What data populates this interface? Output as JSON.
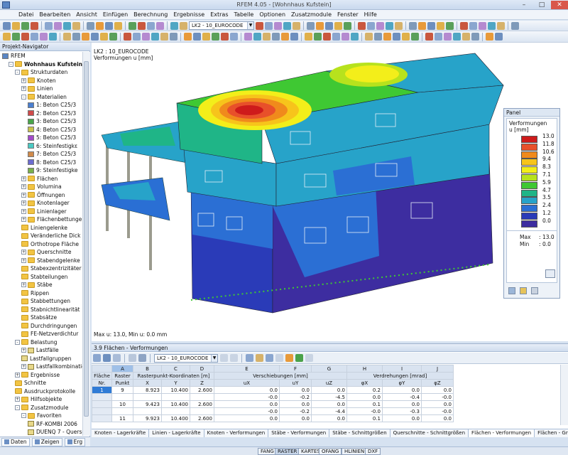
{
  "window": {
    "title": "RFEM 4.05 - [Wohnhaus Kufstein]",
    "controls": [
      "–",
      "□",
      "✕"
    ]
  },
  "menu": [
    "Datei",
    "Bearbeiten",
    "Ansicht",
    "Einfügen",
    "Berechnung",
    "Ergebnisse",
    "Extras",
    "Tabelle",
    "Optionen",
    "Zusatzmodule",
    "Fenster",
    "Hilfe"
  ],
  "toolbar": {
    "loadcase_combo": "LK2 - 10_EUROCODE"
  },
  "navigator": {
    "header": "Projekt-Navigator",
    "tree": [
      {
        "label": "RFEM",
        "level": 0,
        "icon": "rfem"
      },
      {
        "label": "Wohnhaus Kufstein [Eige",
        "level": 1,
        "icon": "folder",
        "bold": true,
        "exp": "-"
      },
      {
        "label": "Strukturdaten",
        "level": 2,
        "icon": "folder",
        "exp": "-"
      },
      {
        "label": "Knoten",
        "level": 3,
        "icon": "folder",
        "exp": "+"
      },
      {
        "label": "Linien",
        "level": 3,
        "icon": "folder",
        "exp": "+"
      },
      {
        "label": "Materialien",
        "level": 3,
        "icon": "folder",
        "exp": "-"
      },
      {
        "label": "1: Beton C25/3",
        "level": 4,
        "icon": "mat",
        "color": "#4a7fd0"
      },
      {
        "label": "2: Beton C25/3",
        "level": 4,
        "icon": "mat",
        "color": "#d04a4a"
      },
      {
        "label": "3: Beton C25/3",
        "level": 4,
        "icon": "mat",
        "color": "#49a54a"
      },
      {
        "label": "4: Beton C25/3",
        "level": 4,
        "icon": "mat",
        "color": "#c9c24a"
      },
      {
        "label": "5: Beton C25/3",
        "level": 4,
        "icon": "mat",
        "color": "#a24ac9"
      },
      {
        "label": "6: Steinfestigkε",
        "level": 4,
        "icon": "mat",
        "color": "#4ac9c2"
      },
      {
        "label": "7: Beton C25/3",
        "level": 4,
        "icon": "mat",
        "color": "#d08a4a"
      },
      {
        "label": "8: Beton C25/3",
        "level": 4,
        "icon": "mat",
        "color": "#6b6bd0"
      },
      {
        "label": "9: Steinfestigke",
        "level": 4,
        "icon": "mat",
        "color": "#7ab04a"
      },
      {
        "label": "Flächen",
        "level": 3,
        "icon": "folder",
        "exp": "+"
      },
      {
        "label": "Volumina",
        "level": 3,
        "icon": "folder",
        "exp": "+"
      },
      {
        "label": "Öffnungen",
        "level": 3,
        "icon": "folder",
        "exp": "+"
      },
      {
        "label": "Knotenlager",
        "level": 3,
        "icon": "folder",
        "exp": "+"
      },
      {
        "label": "Linienlager",
        "level": 3,
        "icon": "folder",
        "exp": "+"
      },
      {
        "label": "Flächenbettungen",
        "level": 3,
        "icon": "folder",
        "exp": "+"
      },
      {
        "label": "Liniengelenke",
        "level": 3,
        "icon": "folder"
      },
      {
        "label": "Veränderliche Dick",
        "level": 3,
        "icon": "folder"
      },
      {
        "label": "Orthotrope Fläche",
        "level": 3,
        "icon": "folder"
      },
      {
        "label": "Querschnitte",
        "level": 3,
        "icon": "folder",
        "exp": "+"
      },
      {
        "label": "Stabendgelenke",
        "level": 3,
        "icon": "folder",
        "exp": "+"
      },
      {
        "label": "Stabexzentrizitäter",
        "level": 3,
        "icon": "folder"
      },
      {
        "label": "Stabteilungen",
        "level": 3,
        "icon": "folder"
      },
      {
        "label": "Stäbe",
        "level": 3,
        "icon": "folder",
        "exp": "+"
      },
      {
        "label": "Rippen",
        "level": 3,
        "icon": "folder"
      },
      {
        "label": "Stabbettungen",
        "level": 3,
        "icon": "folder"
      },
      {
        "label": "Stabnichtlinearität",
        "level": 3,
        "icon": "folder"
      },
      {
        "label": "Stabsätze",
        "level": 3,
        "icon": "folder"
      },
      {
        "label": "Durchdringungen",
        "level": 3,
        "icon": "folder"
      },
      {
        "label": "FE-Netzverdichtur",
        "level": 3,
        "icon": "folder"
      },
      {
        "label": "Belastung",
        "level": 2,
        "icon": "folder",
        "exp": "-"
      },
      {
        "label": "Lastfälle",
        "level": 3,
        "icon": "item",
        "exp": "+"
      },
      {
        "label": "Lastfallgruppen",
        "level": 3,
        "icon": "item"
      },
      {
        "label": "Lastfallkombinatic",
        "level": 3,
        "icon": "item",
        "exp": "+"
      },
      {
        "label": "Ergebnisse",
        "level": 2,
        "icon": "folder",
        "exp": "+"
      },
      {
        "label": "Schnitte",
        "level": 2,
        "icon": "folder"
      },
      {
        "label": "Ausdruckprotokolle",
        "level": 2,
        "icon": "folder"
      },
      {
        "label": "Hilfsobjekte",
        "level": 2,
        "icon": "folder",
        "exp": "+"
      },
      {
        "label": "Zusatzmodule",
        "level": 2,
        "icon": "folder",
        "exp": "-"
      },
      {
        "label": "Favoriten",
        "level": 3,
        "icon": "folder",
        "exp": "-"
      },
      {
        "label": "RF-KOMBI 2006",
        "level": 4,
        "icon": "item"
      },
      {
        "label": "DUENQ 7 - Querse",
        "level": 4,
        "icon": "item"
      }
    ],
    "tabs": [
      "Daten",
      "Zeigen",
      "Erg"
    ]
  },
  "viewport": {
    "title_line1": "LK2 : 10_EUROCODE",
    "title_line2": "Verformungen u [mm]",
    "footer": "Max u: 13.0, Min u: 0.0 mm"
  },
  "panel": {
    "title": "Panel",
    "heading1": "Verformungen",
    "heading2": "u [mm]",
    "legend": [
      {
        "value": "13.0",
        "color": "#ce1b1b"
      },
      {
        "value": "11.8",
        "color": "#e8502a"
      },
      {
        "value": "10.6",
        "color": "#f08a1c"
      },
      {
        "value": "9.4",
        "color": "#f7c41b"
      },
      {
        "value": "8.3",
        "color": "#f3ee1a"
      },
      {
        "value": "7.1",
        "color": "#b7e21d"
      },
      {
        "value": "5.9",
        "color": "#3fc833"
      },
      {
        "value": "4.7",
        "color": "#1fb587"
      },
      {
        "value": "3.5",
        "color": "#27a3c9"
      },
      {
        "value": "2.4",
        "color": "#2b6fd4"
      },
      {
        "value": "1.2",
        "color": "#2a3bb8"
      },
      {
        "value": "0.0",
        "color": "#3d2da0"
      }
    ],
    "max_label": "Max",
    "max_value": "13.0",
    "min_label": "Min",
    "min_value": "0.0"
  },
  "table": {
    "title": "3.9 Flächen - Verformungen",
    "combo": "LK2 - 10_EUROCODE",
    "col_letters": [
      "A",
      "B",
      "C",
      "D",
      "E",
      "F",
      "G",
      "H",
      "I",
      "J"
    ],
    "group_headers": {
      "flaeche": "Fläche",
      "raster": "Raster",
      "coords": "Rasterpunkt-Koordinaten [m]",
      "versch": "Verschiebungen [mm]",
      "verdreh": "Verdrehungen [mrad]"
    },
    "sub_headers": [
      "Nr.",
      "Punkt",
      "X",
      "Y",
      "Z",
      "uX",
      "uY",
      "uZ",
      "φX",
      "φY",
      "φZ"
    ],
    "rows": [
      [
        "1",
        "9",
        "8.923",
        "10.400",
        "2.600",
        "0.0",
        "0.0",
        "0.0",
        "0.2",
        "0.0",
        "0.0"
      ],
      [
        "",
        "",
        "",
        "",
        "",
        "-0.0",
        "-0.2",
        "-4.5",
        "0.0",
        "-0.4",
        "-0.0"
      ],
      [
        "",
        "10",
        "9.423",
        "10.400",
        "2.600",
        "0.0",
        "0.0",
        "0.0",
        "0.1",
        "0.0",
        "0.0"
      ],
      [
        "",
        "",
        "",
        "",
        "",
        "-0.0",
        "-0.2",
        "-4.4",
        "-0.0",
        "-0.3",
        "-0.0"
      ],
      [
        "",
        "11",
        "9.923",
        "10.400",
        "2.600",
        "0.0",
        "0.0",
        "0.0",
        "0.1",
        "0.0",
        "0.0"
      ]
    ],
    "sheet_tabs": [
      "Knoten - Lagerkräfte",
      "Linien - Lagerkräfte",
      "Knoten - Verformungen",
      "Stäbe - Verformungen",
      "Stäbe - Schnittgrößen",
      "Querschnitte - Schnittgrößen",
      "Flächen - Verformungen",
      "Flächen - Grundschnittgrößen"
    ],
    "active_tab": 6
  },
  "statusbar": [
    "FANG",
    "RASTER",
    "KARTES",
    "OFANG",
    "HLINIEN",
    "DXF"
  ]
}
